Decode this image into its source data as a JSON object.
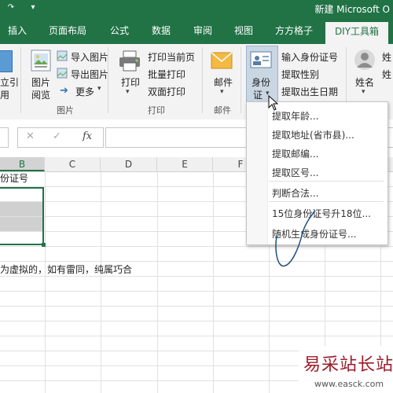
{
  "titlebar": {
    "title": "新建 Microsoft O"
  },
  "tabs": [
    "插入",
    "页面布局",
    "公式",
    "数据",
    "审阅",
    "视图",
    "方方格子",
    "DIY工具箱"
  ],
  "ribbon": {
    "partial_left_label": "立引",
    "partial_left_sub": "用",
    "image_group": {
      "big_button": "图片",
      "big_button_line2": "阅览",
      "items": [
        "导入图片",
        "导出图片",
        "更多"
      ],
      "group_label": "图片"
    },
    "print_group": {
      "big_button": "打印",
      "items": [
        "打印当前页",
        "批量打印",
        "双面打印"
      ],
      "group_label": "打印"
    },
    "mail_group": {
      "big_button": "邮件",
      "group_label": "邮件"
    },
    "id_group": {
      "big_button_line1": "身份",
      "big_button_line2": "证",
      "items": [
        "输入身份证号",
        "提取性别",
        "提取出生日期"
      ]
    },
    "name_group": {
      "big_button": "姓名",
      "partial_right_1": "姓",
      "partial_right_2": "姓"
    }
  },
  "formula_bar": {
    "cancel": "✕",
    "confirm": "✓",
    "fx": "fx",
    "value": ""
  },
  "grid": {
    "columns": [
      "B",
      "C",
      "D",
      "E",
      "F"
    ],
    "cell_b1": "份证号",
    "note": "为虚拟的，如有雷同，纯属巧合"
  },
  "dropdown": {
    "items": [
      "提取年龄...",
      "提取地址(省市县)...",
      "提取邮编...",
      "提取区号...",
      "判断合法...",
      "15位身份证号升18位...",
      "随机生成身份证号..."
    ]
  },
  "watermark": {
    "text": "易采站长站",
    "url": "www.easck.com"
  },
  "colors": {
    "excel_green": "#217346",
    "ribbon_bg": "#f3f3f3"
  }
}
